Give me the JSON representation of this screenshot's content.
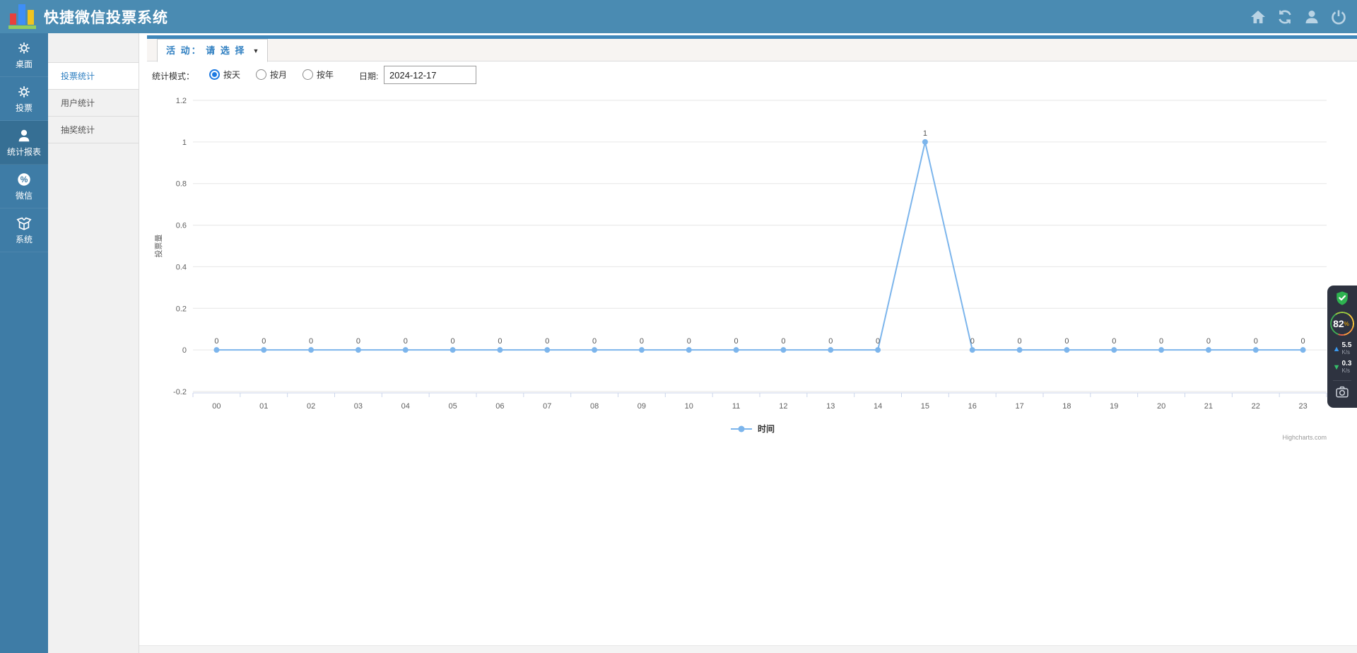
{
  "header": {
    "title": "快捷微信投票系统",
    "icons": [
      {
        "name": "home"
      },
      {
        "name": "refresh"
      },
      {
        "name": "user"
      },
      {
        "name": "power"
      }
    ]
  },
  "sidebar": {
    "items": [
      {
        "label": "桌面",
        "icon": "gear",
        "active": false
      },
      {
        "label": "投票",
        "icon": "gear",
        "active": false
      },
      {
        "label": "统计报表",
        "icon": "user",
        "active": true
      },
      {
        "label": "微信",
        "icon": "percent-badge",
        "active": false
      },
      {
        "label": "系统",
        "icon": "open-box",
        "active": false
      }
    ]
  },
  "subnav": {
    "items": [
      {
        "label": "投票统计",
        "active": true
      },
      {
        "label": "用户统计",
        "active": false
      },
      {
        "label": "抽奖统计",
        "active": false
      }
    ]
  },
  "toolbar": {
    "activity_tab_label": "活 动： 请 选 择",
    "caret": "▼"
  },
  "filters": {
    "mode_label": "统计模式：",
    "modes": [
      {
        "label": "按天",
        "selected": true
      },
      {
        "label": "按月",
        "selected": false
      },
      {
        "label": "按年",
        "selected": false
      }
    ],
    "date_label": "日期:",
    "date_value": "2024-12-17"
  },
  "chart_data": {
    "type": "line",
    "categories": [
      "00",
      "01",
      "02",
      "03",
      "04",
      "05",
      "06",
      "07",
      "08",
      "09",
      "10",
      "11",
      "12",
      "13",
      "14",
      "15",
      "16",
      "17",
      "18",
      "19",
      "20",
      "21",
      "22",
      "23"
    ],
    "series": [
      {
        "name": "时间",
        "values": [
          0,
          0,
          0,
          0,
          0,
          0,
          0,
          0,
          0,
          0,
          0,
          0,
          0,
          0,
          0,
          1,
          0,
          0,
          0,
          0,
          0,
          0,
          0,
          0
        ]
      }
    ],
    "title": "",
    "xlabel": "",
    "ylabel": "投票量",
    "ylim": [
      -0.2,
      1.2
    ],
    "ytick_interval": 0.2,
    "grid": true,
    "legend_position": "bottom-center",
    "line_color": "#7cb5ec",
    "grid_color": "#e6e6e6",
    "axis_color": "#ccd6eb",
    "label_color": "#606060",
    "data_label_color": "#555555",
    "credit": "Highcharts.com"
  },
  "widget": {
    "percent": "82",
    "percent_sign": "%",
    "upload_value": "5.5",
    "upload_unit": "K/s",
    "download_value": "0.3",
    "download_unit": "K/s"
  },
  "colors": {
    "header_bg": "#4a8bb2",
    "sidenav_bg": "#3e7ca6",
    "sidenav_active_bg": "#366f94",
    "accent_blue": "#2f7fc1",
    "chart_line": "#7cb5ec",
    "widget_bg": "#2e3340"
  }
}
